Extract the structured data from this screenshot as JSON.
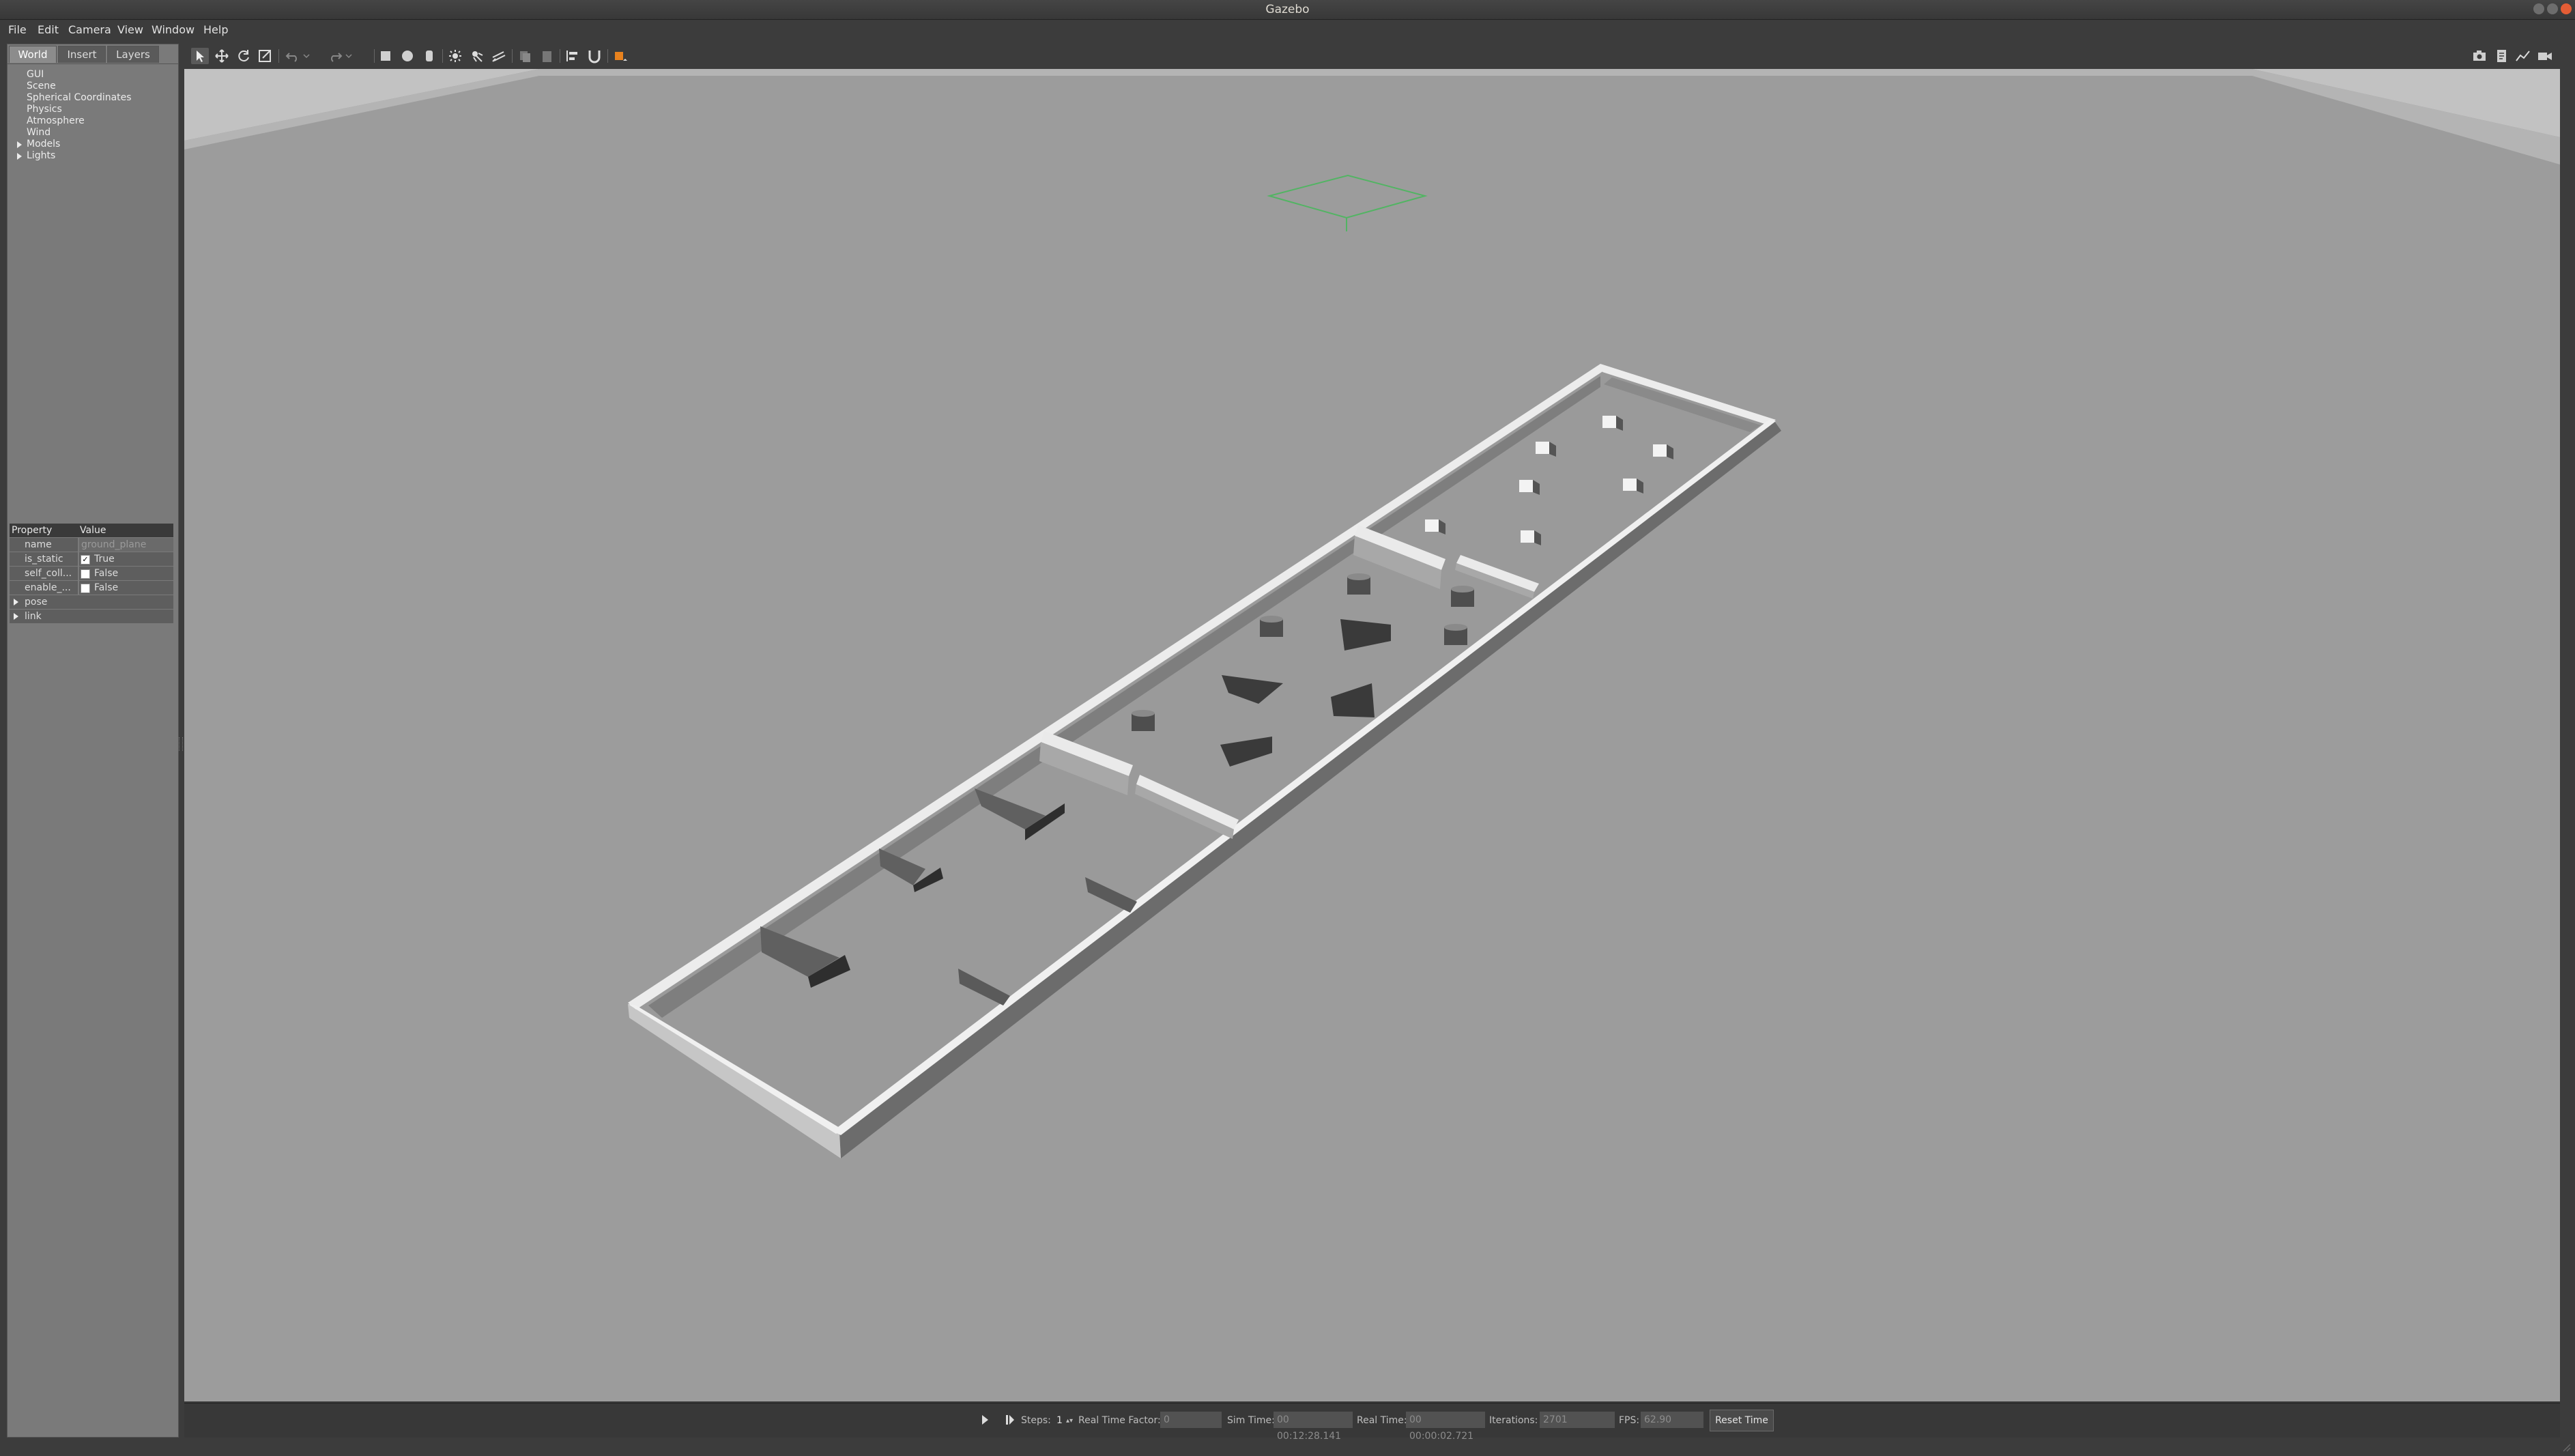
{
  "window": {
    "title": "Gazebo"
  },
  "menu": {
    "items": [
      "File",
      "Edit",
      "Camera",
      "View",
      "Window",
      "Help"
    ]
  },
  "left_panel": {
    "tabs": [
      "World",
      "Insert",
      "Layers"
    ],
    "active_tab": "World",
    "tree": [
      "GUI",
      "Scene",
      "Spherical Coordinates",
      "Physics",
      "Atmosphere",
      "Wind",
      "Models",
      "Lights"
    ],
    "expandable": [
      "Models",
      "Lights"
    ]
  },
  "properties": {
    "headers": [
      "Property",
      "Value"
    ],
    "rows": [
      {
        "name": "name",
        "value": "ground_plane"
      },
      {
        "name": "is_static",
        "value": "True",
        "checked": true
      },
      {
        "name": "self_coll...",
        "value": "False",
        "checked": false
      },
      {
        "name": "enable_...",
        "value": "False",
        "checked": false
      },
      {
        "name": "pose",
        "value": ""
      },
      {
        "name": "link",
        "value": ""
      }
    ]
  },
  "toolbar": {
    "left_icons": [
      "select-arrow-icon",
      "translate-icon",
      "rotate-icon",
      "scale-icon",
      "undo-icon",
      "undo-history-icon",
      "redo-icon",
      "redo-history-icon",
      "box-icon",
      "sphere-icon",
      "cylinder-icon",
      "point-light-icon",
      "spot-light-icon",
      "directional-light-icon",
      "copy-icon",
      "paste-icon",
      "align-icon",
      "snap-icon",
      "change-view-icon"
    ],
    "right_icons": [
      "screenshot-icon",
      "log-icon",
      "plot-icon",
      "video-record-icon"
    ]
  },
  "status_bar": {
    "steps_label": "Steps:",
    "steps_value": "1",
    "real_time_factor_label": "Real Time Factor:",
    "real_time_factor_value": "0",
    "sim_time_label": "Sim Time:",
    "sim_time_value": "00 00:12:28.141",
    "real_time_label": "Real Time:",
    "real_time_value": "00 00:00:02.721",
    "iterations_label": "Iterations:",
    "iterations_value": "2701",
    "fps_label": "FPS:",
    "fps_value": "62.90",
    "reset_label": "Reset Time"
  },
  "colors": {
    "background": "#9c9c9c",
    "walls": "#e6e6e6",
    "obstacles": "#5a5a5a",
    "panel": "#7a7a7a",
    "chrome": "#3c3c3c"
  }
}
